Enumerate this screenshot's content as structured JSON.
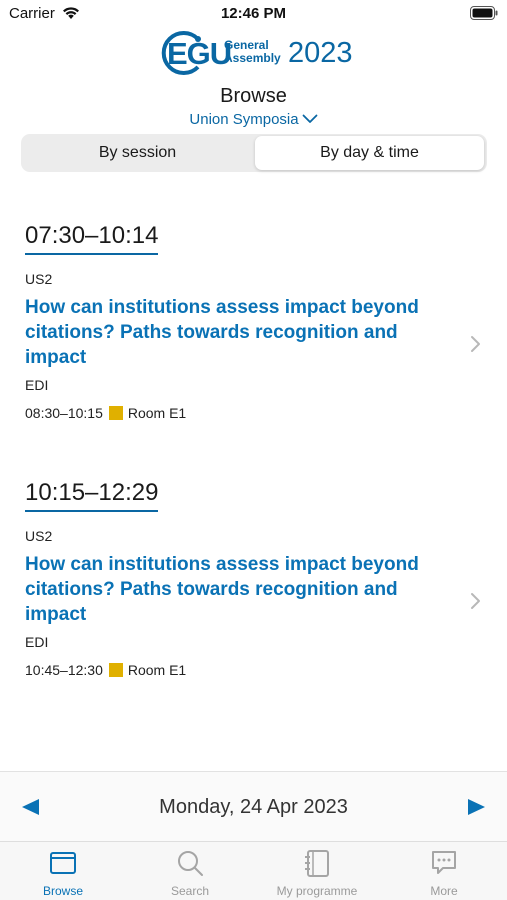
{
  "status_bar": {
    "carrier": "Carrier",
    "time": "12:46 PM",
    "icons": [
      "wifi-icon",
      "battery-icon"
    ]
  },
  "logo": {
    "brand": "EGU",
    "line1": "General",
    "line2": "Assembly",
    "year": "2023",
    "color": "#0a67a3"
  },
  "header": {
    "title": "Browse",
    "filter_label": "Union Symposia",
    "filter_icon": "chevron-down-icon"
  },
  "segmented": {
    "options": [
      "By session",
      "By day & time"
    ],
    "selected": "By day & time"
  },
  "slots": [
    {
      "time_range": "07:30–10:14",
      "code": "US2",
      "title": "How can institutions assess impact beyond citations? Paths towards recognition and impact",
      "org": "EDI",
      "session_time": "08:30–10:15",
      "room": "Room E1",
      "room_color": "#e0b000"
    },
    {
      "time_range": "10:15–12:29",
      "code": "US2",
      "title": "How can institutions assess impact beyond citations? Paths towards recognition and impact",
      "org": "EDI",
      "session_time": "10:45–12:30",
      "room": "Room E1",
      "room_color": "#e0b000"
    }
  ],
  "date_nav": {
    "date": "Monday, 24 Apr 2023",
    "prev_icon": "triangle-left-icon",
    "next_icon": "triangle-right-icon"
  },
  "tab_bar": {
    "tabs": [
      {
        "label": "Browse",
        "icon": "browse-window-icon",
        "active": true
      },
      {
        "label": "Search",
        "icon": "search-icon",
        "active": false
      },
      {
        "label": "My programme",
        "icon": "notebook-icon",
        "active": false
      },
      {
        "label": "More",
        "icon": "chat-bubble-icon",
        "active": false
      }
    ]
  },
  "colors": {
    "accent": "#0a72b5",
    "inactive_tab": "#9a9a9a"
  }
}
